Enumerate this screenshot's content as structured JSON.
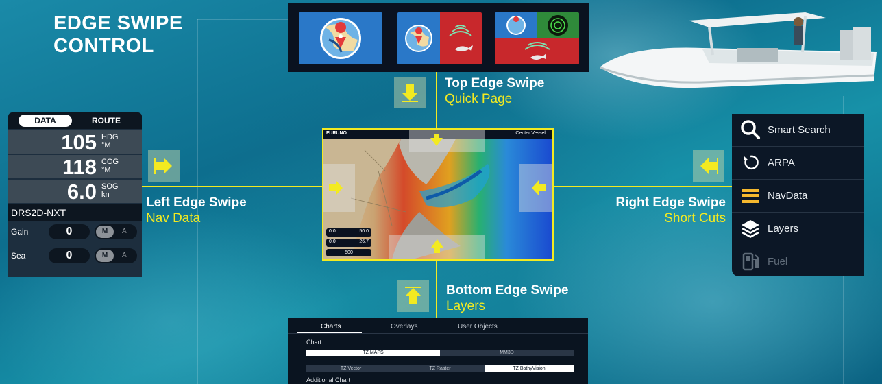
{
  "title": "EDGE SWIPE CONTROL",
  "top_label": "Top Edge Swipe",
  "top_sub": "Quick Page",
  "left_label": "Left Edge Swipe",
  "left_sub": "Nav Data",
  "right_label": "Right Edge Swipe",
  "right_sub": "Short Cuts",
  "bottom_label": "Bottom Edge Swipe",
  "bottom_sub": "Layers",
  "data_panel": {
    "tab_data": "DATA",
    "tab_route": "ROUTE",
    "rows": [
      {
        "value": "105",
        "unit1": "HDG",
        "unit2": "°M"
      },
      {
        "value": "118",
        "unit1": "COG",
        "unit2": "°M"
      },
      {
        "value": "6.0",
        "unit1": "SOG",
        "unit2": "kn"
      }
    ],
    "radar_name": "DRS2D-NXT",
    "gain_label": "Gain",
    "gain_value": "0",
    "sea_label": "Sea",
    "sea_value": "0",
    "toggle_m": "M",
    "toggle_a": "A"
  },
  "shortcuts": [
    {
      "label": "Smart Search",
      "icon": "magnifier-icon"
    },
    {
      "label": "ARPA",
      "icon": "arpa-icon"
    },
    {
      "label": "NavData",
      "icon": "navdata-icon"
    },
    {
      "label": "Layers",
      "icon": "layers-icon"
    },
    {
      "label": "Fuel",
      "icon": "fuel-pump-icon"
    }
  ],
  "chart_panel": {
    "tabs": [
      "Charts",
      "Overlays",
      "User Objects"
    ],
    "section": "Chart",
    "opt1": "TZ MAPS",
    "opt2": "MM3D",
    "opt3": "TZ Vector",
    "opt4": "TZ Raster",
    "opt5": "TZ BathyVision",
    "section2": "Additional Chart"
  },
  "map": {
    "brand": "FURUNO",
    "center_vessel": "Center Vessel",
    "g1_left": "0.0",
    "g1_right": "50.0",
    "g2_left": "0.0",
    "g2_right": "26.7",
    "scale": "500"
  },
  "colors": {
    "accent": "#f3ea21"
  }
}
